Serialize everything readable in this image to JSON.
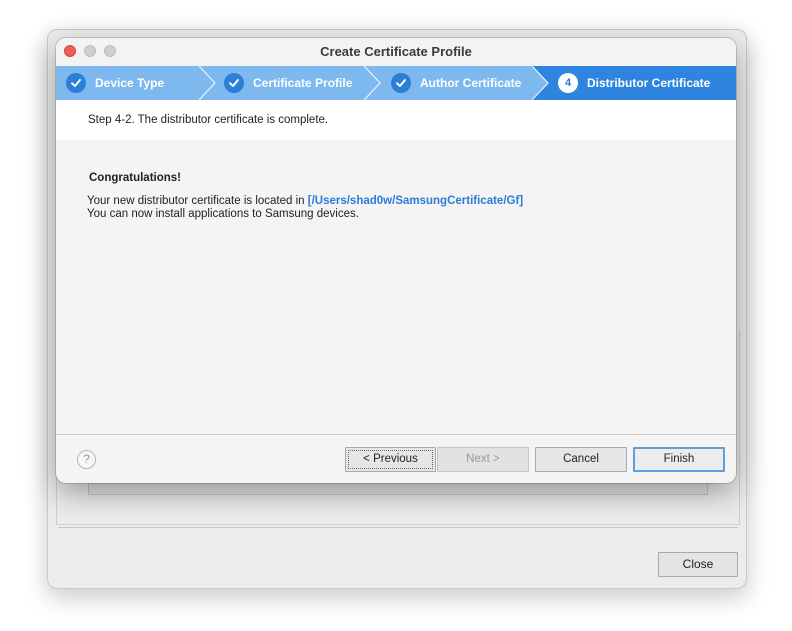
{
  "dialog": {
    "title": "Create Certificate Profile",
    "steps": [
      {
        "label": "Device Type",
        "state": "done"
      },
      {
        "label": "Certificate Profile",
        "state": "done"
      },
      {
        "label": "Author Certificate",
        "state": "done"
      },
      {
        "label": "Distributor Certificate",
        "state": "active",
        "number": "4"
      }
    ],
    "step_description": "Step 4-2. The distributor certificate is complete.",
    "congrats": "Congratulations!",
    "location_prefix": "Your new distributor certificate is located in ",
    "location_path": "[/Users/shad0w/SamsungCertificate/Gf]",
    "install_note": "You can now install applications to Samsung devices.",
    "help_symbol": "?",
    "buttons": {
      "previous": "< Previous",
      "next": "Next >",
      "cancel": "Cancel",
      "finish": "Finish"
    }
  },
  "background_window": {
    "close_label": "Close"
  },
  "colors": {
    "step_bar": "#7db8ee",
    "step_active": "#2f84e0",
    "link": "#2c7bd6",
    "close_light": "#ec5f57"
  },
  "icons": {
    "step_done": "checkmark-circle-icon",
    "help": "question-circle-icon"
  }
}
